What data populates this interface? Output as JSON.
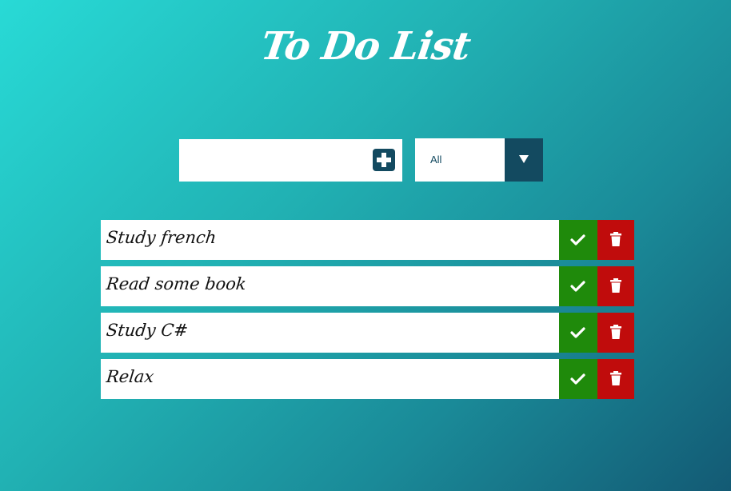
{
  "header": {
    "title": "To Do List"
  },
  "input": {
    "value": "",
    "placeholder": ""
  },
  "add_button": {
    "icon": "plus-square-icon"
  },
  "filter": {
    "selected": "All",
    "icon": "caret-down-icon"
  },
  "todos": [
    {
      "text": "Study french"
    },
    {
      "text": "Read some book"
    },
    {
      "text": "Study C#"
    },
    {
      "text": "Relax"
    }
  ],
  "colors": {
    "complete": "#1f8a0b",
    "delete": "#c00c0c",
    "accent": "#134a60",
    "gradient_start": "#28dad6",
    "gradient_end": "#135a74"
  }
}
